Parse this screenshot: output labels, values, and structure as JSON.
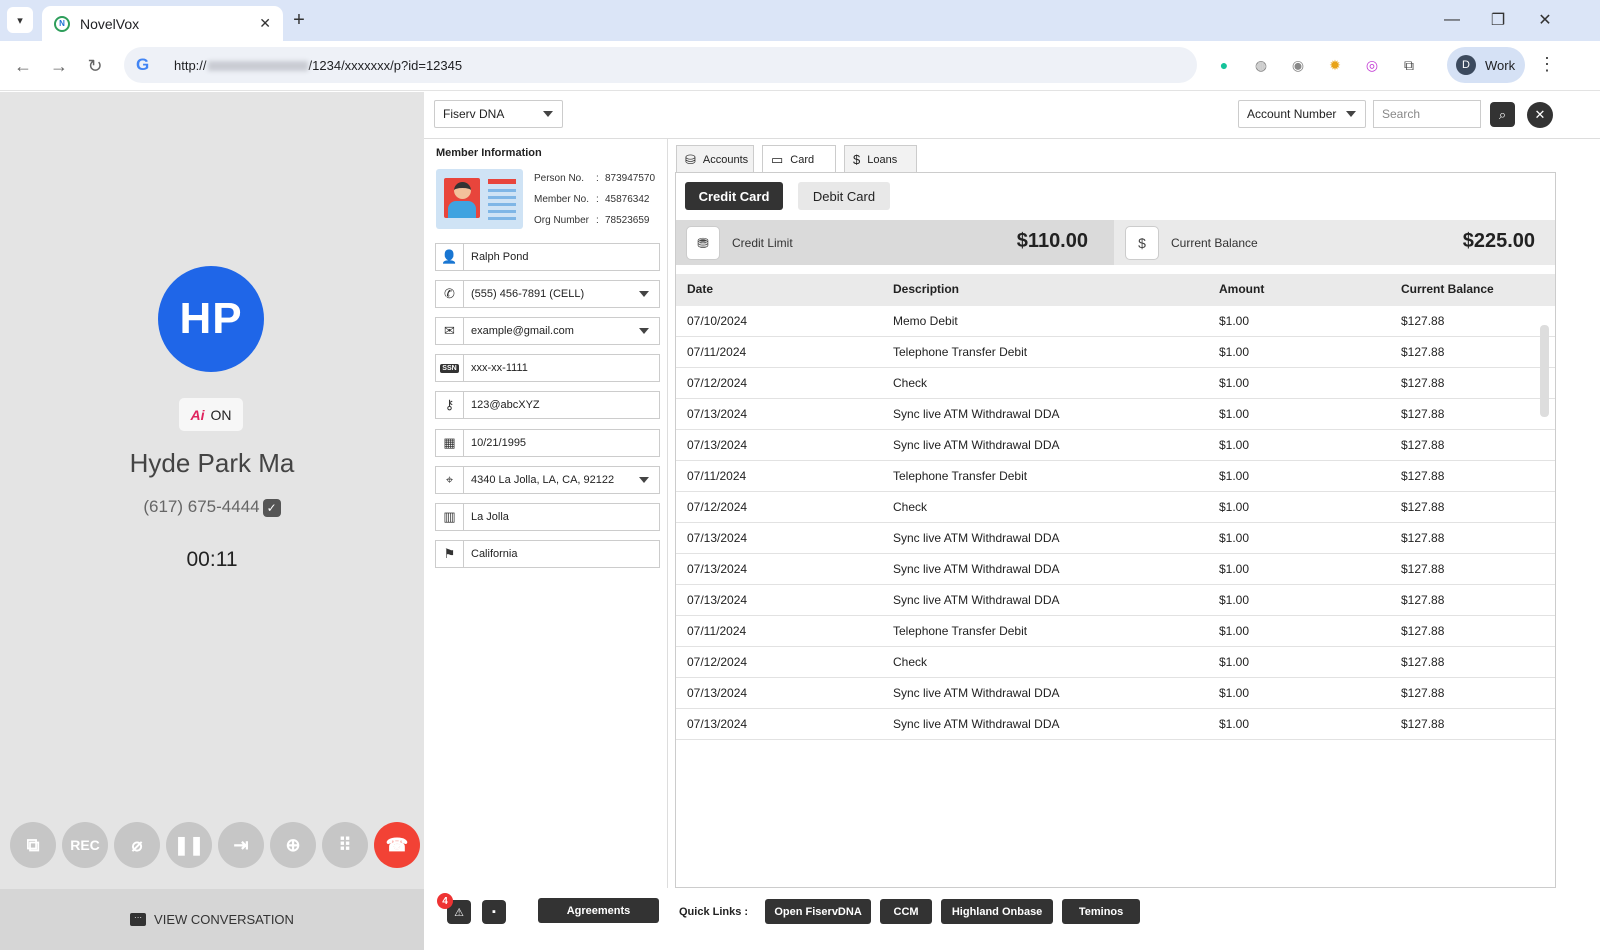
{
  "browser": {
    "tab_title": "NovelVox",
    "favicon": "N",
    "url_prefix": "http://",
    "url_suffix": "/1234/xxxxxxx/p?id=12345",
    "profile_initial": "D",
    "profile_name": "Work"
  },
  "call": {
    "avatar_initials": "HP",
    "ai_badge_icon": "Ai",
    "ai_status": "ON",
    "caller_name": "Hyde Park Ma",
    "caller_number": "(617) 675-4444",
    "timer": "00:11",
    "controls": [
      "screen-share",
      "REC",
      "mute",
      "hold",
      "transfer",
      "add-participant",
      "dialpad",
      "end-call"
    ],
    "rec_label": "REC",
    "view_conversation": "VIEW CONVERSATION"
  },
  "crm": {
    "system_select": "Fiserv DNA",
    "search_type": "Account Number",
    "search_placeholder": "Search"
  },
  "member": {
    "title": "Member Information",
    "ids": [
      {
        "label": "Person No.",
        "value": "873947570"
      },
      {
        "label": "Member No.",
        "value": "45876342"
      },
      {
        "label": "Org Number",
        "value": "78523659"
      }
    ],
    "name": "Ralph Pond",
    "phone": "(555) 456-7891 (CELL)",
    "email": "example@gmail.com",
    "ssn_icon": "SSN",
    "ssn": "xxx-xx-1111",
    "password": "123@abcXYZ",
    "dob": "10/21/1995",
    "address": "4340 La Jolla, LA, CA, 92122",
    "city": "La Jolla",
    "state": "California"
  },
  "tabs": [
    "Accounts",
    "Card",
    "Loans"
  ],
  "card": {
    "credit_card": "Credit Card",
    "debit_card": "Debit Card",
    "credit_limit_label": "Credit Limit",
    "credit_limit_value": "$110.00",
    "current_balance_label": "Current Balance",
    "current_balance_value": "$225.00"
  },
  "table": {
    "headers": [
      "Date",
      "Description",
      "Amount",
      "Current Balance"
    ],
    "rows": [
      [
        "07/10/2024",
        "Memo Debit",
        "$1.00",
        "$127.88"
      ],
      [
        "07/11/2024",
        "Telephone Transfer Debit",
        "$1.00",
        "$127.88"
      ],
      [
        "07/12/2024",
        "Check",
        "$1.00",
        "$127.88"
      ],
      [
        "07/13/2024",
        "Sync live ATM Withdrawal DDA",
        "$1.00",
        "$127.88"
      ],
      [
        "07/13/2024",
        "Sync live ATM Withdrawal DDA",
        "$1.00",
        "$127.88"
      ],
      [
        "07/11/2024",
        "Telephone Transfer Debit",
        "$1.00",
        "$127.88"
      ],
      [
        "07/12/2024",
        "Check",
        "$1.00",
        "$127.88"
      ],
      [
        "07/13/2024",
        "Sync live ATM Withdrawal DDA",
        "$1.00",
        "$127.88"
      ],
      [
        "07/13/2024",
        "Sync live ATM Withdrawal DDA",
        "$1.00",
        "$127.88"
      ],
      [
        "07/13/2024",
        "Sync live ATM Withdrawal DDA",
        "$1.00",
        "$127.88"
      ],
      [
        "07/11/2024",
        "Telephone Transfer Debit",
        "$1.00",
        "$127.88"
      ],
      [
        "07/12/2024",
        "Check",
        "$1.00",
        "$127.88"
      ],
      [
        "07/13/2024",
        "Sync live ATM Withdrawal DDA",
        "$1.00",
        "$127.88"
      ],
      [
        "07/13/2024",
        "Sync live ATM Withdrawal DDA",
        "$1.00",
        "$127.88"
      ]
    ]
  },
  "bottom": {
    "alert_count": "4",
    "agreements": "Agreements",
    "quick_links_label": "Quick Links :",
    "quick_links": [
      "Open FiservDNA",
      "CCM",
      "Highland Onbase",
      "Teminos"
    ]
  },
  "colors": {
    "accent_dark": "#333333",
    "avatar_blue": "#1f66e8",
    "end_call_red": "#f24235",
    "badge_red": "#e33333"
  }
}
